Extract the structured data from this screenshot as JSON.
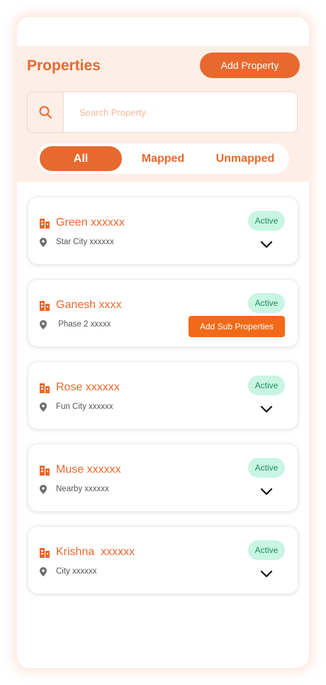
{
  "header": {
    "title": "Properties",
    "add_button": "Add Property"
  },
  "search": {
    "placeholder": "Search Property",
    "value": ""
  },
  "tabs": [
    {
      "label": "All",
      "active": true
    },
    {
      "label": "Mapped",
      "active": false
    },
    {
      "label": "Unmapped",
      "active": false
    }
  ],
  "properties": [
    {
      "name": "Green xxxxxx",
      "location": "Star City xxxxxx",
      "status": "Active",
      "action": "chevron-down-icon"
    },
    {
      "name": "Ganesh xxxx",
      "location": " Phase 2 xxxxx",
      "status": "Active",
      "action_label": "Add Sub Properties"
    },
    {
      "name": "Rose xxxxxx",
      "location": "Fun City xxxxxx",
      "status": "Active",
      "action": "chevron-down-icon"
    },
    {
      "name": "Muse xxxxxx",
      "location": "Nearby xxxxxx",
      "status": "Active",
      "action": "chevron-down-icon"
    },
    {
      "name": "Krishna  xxxxxx",
      "location": "City xxxxxx",
      "status": "Active",
      "action": "chevron-down-icon"
    }
  ],
  "colors": {
    "accent": "#e8692e",
    "header_bg": "#fdeee6",
    "badge_bg": "#c9f5e4",
    "badge_text": "#1f8f63",
    "sub_button": "#f26a17"
  }
}
